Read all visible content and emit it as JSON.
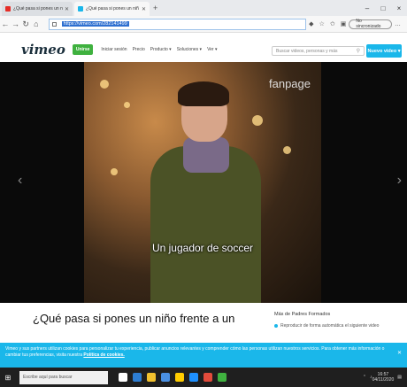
{
  "browser": {
    "tabs": [
      {
        "title": "¿Qué pasa si pones un niño fren",
        "color": "#e52d27"
      },
      {
        "title": "¿Qué pasa si pones un niñ",
        "color": "#1ab7ea"
      }
    ],
    "new_tab": "+",
    "url": "https://vimeo.com/282141499",
    "profile": "No sincronizado",
    "controls": [
      "–",
      "□",
      "×"
    ]
  },
  "vimeo": {
    "logo": "vimeo",
    "join": "Unirse",
    "nav": [
      "Iniciar sesión",
      "Precio",
      "Producto ▾",
      "Soluciones ▾",
      "Ver ▾"
    ],
    "search_placeholder": "Buscar videos, personas y más",
    "new_video": "Nuevo video ▾"
  },
  "video": {
    "caption": "Un jugador de soccer",
    "watermark": "fanpage",
    "title": "¿Qué pasa si pones un niño frente a un"
  },
  "related": {
    "heading": "Más de Padres Formados",
    "item": "Reproducir de forma automática el siguiente video"
  },
  "cookie": {
    "text": "Vimeo y sus partners utilizan cookies para personalizar tu experiencia, publicar anuncios relevantes y comprender cómo las personas utilizan nuestros servicios. Para obtener más información o cambiar tus preferencias, visita nuestra",
    "link": "Política de cookies."
  },
  "taskbar": {
    "search": "Escribe aquí para buscar",
    "time": "16:57",
    "date": "04/11/2020"
  }
}
